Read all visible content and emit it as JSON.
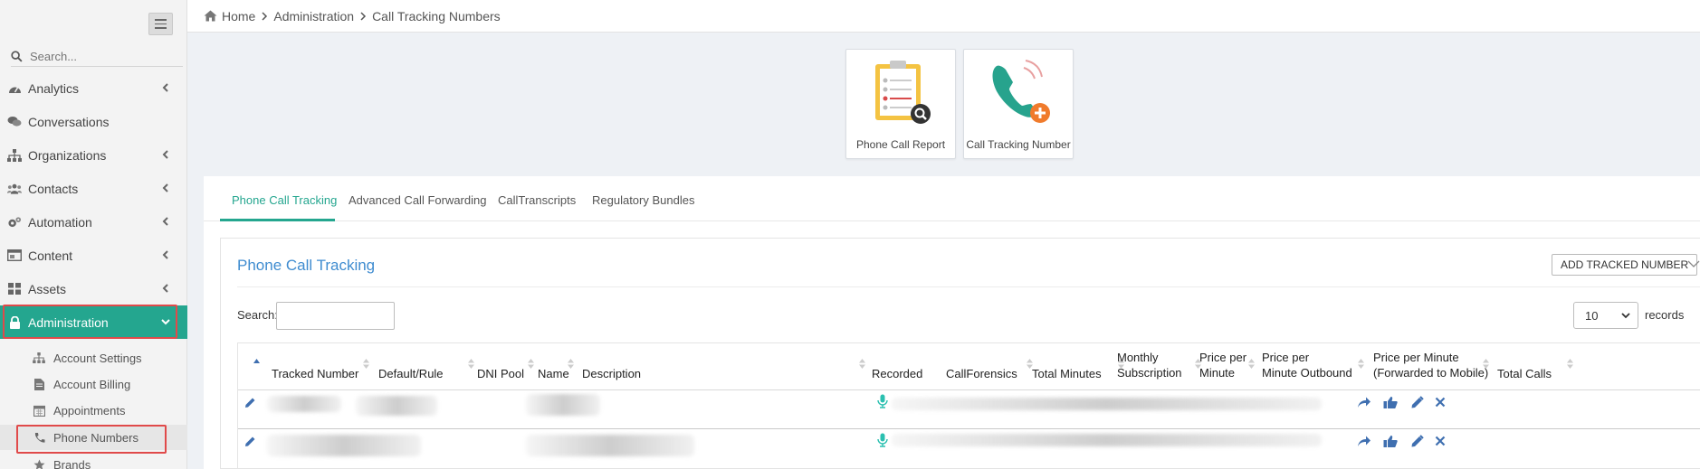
{
  "sidebar": {
    "search_placeholder": "Search...",
    "items": [
      {
        "label": "Analytics"
      },
      {
        "label": "Conversations"
      },
      {
        "label": "Organizations"
      },
      {
        "label": "Contacts"
      },
      {
        "label": "Automation"
      },
      {
        "label": "Content"
      },
      {
        "label": "Assets"
      },
      {
        "label": "Administration"
      }
    ],
    "subitems": [
      {
        "label": "Account Settings"
      },
      {
        "label": "Account Billing"
      },
      {
        "label": "Appointments"
      },
      {
        "label": "Phone Numbers"
      },
      {
        "label": "Brands"
      }
    ]
  },
  "breadcrumb": {
    "home": "Home",
    "section": "Administration",
    "page": "Call Tracking Numbers"
  },
  "tiles": [
    {
      "label": "Phone Call Report"
    },
    {
      "label": "Call Tracking Number"
    }
  ],
  "tabs": [
    {
      "label": "Phone Call Tracking"
    },
    {
      "label": "Advanced Call Forwarding"
    },
    {
      "label": "CallTranscripts"
    },
    {
      "label": "Regulatory Bundles"
    }
  ],
  "card": {
    "title": "Phone Call Tracking",
    "add_button": "ADD TRACKED NUMBER",
    "search_label": "Search:",
    "length_value": "10",
    "records_label": "records"
  },
  "table": {
    "headers": {
      "tracked_number": "Tracked Number",
      "default_rule": "Default/Rule",
      "dni_pool": "DNI Pool",
      "name": "Name",
      "description": "Description",
      "recorded": "Recorded",
      "callforensics": "CallForensics",
      "total_minutes": "Total Minutes",
      "monthly_1": "Monthly",
      "monthly_2": "Subscription",
      "ppm_1": "Price per",
      "ppm_2": "Minute",
      "ppmo_1": "Price per",
      "ppmo_2": "Minute Outbound",
      "ppmf_1": "Price per Minute",
      "ppmf_2": "(Forwarded to Mobile)",
      "total_calls": "Total Calls"
    }
  },
  "colors": {
    "accent": "#24a68f",
    "link": "#3f8cd0",
    "highlight": "#e04a4a"
  }
}
